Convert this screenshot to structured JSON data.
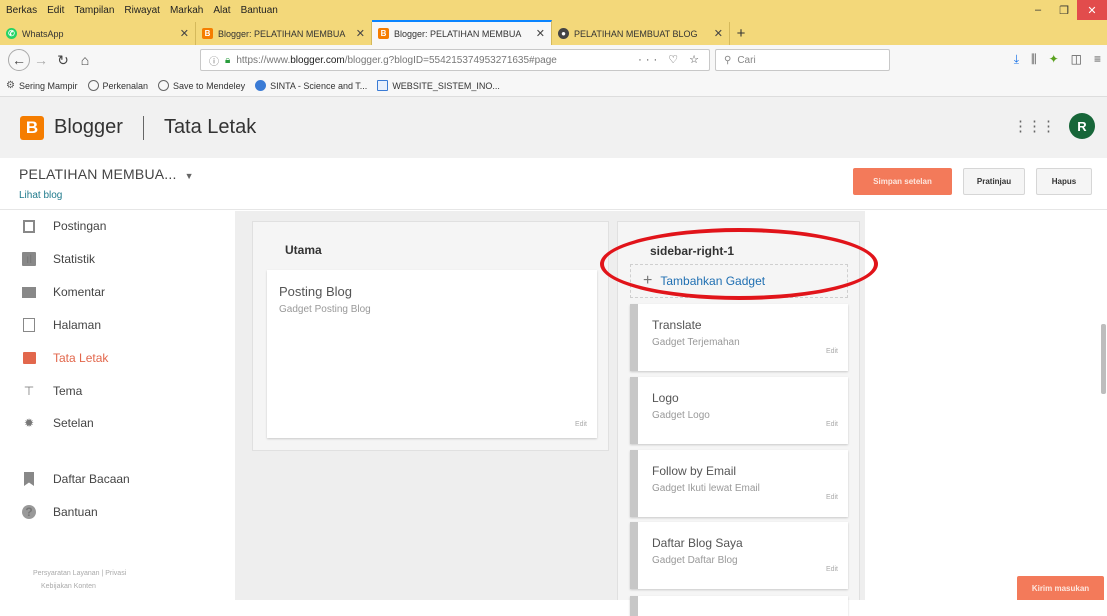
{
  "browser": {
    "menu": [
      "Berkas",
      "Edit",
      "Tampilan",
      "Riwayat",
      "Markah",
      "Alat",
      "Bantuan"
    ],
    "tabs": [
      {
        "label": "WhatsApp",
        "favicon": "whatsapp-icon",
        "active": false
      },
      {
        "label": "Blogger: PELATIHAN MEMBUA",
        "favicon": "blogger-icon",
        "active": false
      },
      {
        "label": "Blogger: PELATIHAN MEMBUA",
        "favicon": "blogger-icon",
        "active": true
      },
      {
        "label": "PELATIHAN MEMBUAT BLOG",
        "favicon": "globe-icon",
        "active": false
      }
    ],
    "url_prefix": "https://www.",
    "url_host": "blogger.com",
    "url_rest": "/blogger.g?blogID=554215374953271635#page",
    "search_placeholder": "Cari",
    "bookmarks": [
      {
        "label": "Sering Mampir",
        "icon": "gear-icon"
      },
      {
        "label": "Perkenalan",
        "icon": "globe-icon"
      },
      {
        "label": "Save to Mendeley",
        "icon": "globe-icon"
      },
      {
        "label": "SINTA - Science and T...",
        "icon": "sinta-icon"
      },
      {
        "label": "WEBSITE_SISTEM_INO...",
        "icon": "page-icon"
      }
    ]
  },
  "header": {
    "brand": "Blogger",
    "title": "Tata Letak",
    "avatar_initial": "R"
  },
  "blog": {
    "name": "PELATIHAN MEMBUA...",
    "view_link": "Lihat blog",
    "save_label": "Simpan setelan",
    "preview_label": "Pratinjau",
    "delete_label": "Hapus"
  },
  "sidebar": {
    "items": [
      {
        "label": "Postingan",
        "icon": "posts-icon"
      },
      {
        "label": "Statistik",
        "icon": "stats-icon"
      },
      {
        "label": "Komentar",
        "icon": "comment-icon"
      },
      {
        "label": "Halaman",
        "icon": "page-icon"
      },
      {
        "label": "Tata Letak",
        "icon": "layout-icon",
        "active": true
      },
      {
        "label": "Tema",
        "icon": "paint-roller-icon"
      },
      {
        "label": "Setelan",
        "icon": "gear-icon"
      },
      {
        "label": "Daftar Bacaan",
        "icon": "bookmark-icon"
      },
      {
        "label": "Bantuan",
        "icon": "help-icon"
      }
    ],
    "footer_line1": "Persyaratan Layanan  |  Privasi",
    "footer_line2": "Kebijakan Konten"
  },
  "layout": {
    "main": {
      "title": "Utama",
      "gadget": {
        "title": "Posting Blog",
        "subtitle": "Gadget Posting Blog",
        "edit": "Edit"
      }
    },
    "sidebar_right": {
      "title": "sidebar-right-1",
      "add_gadget": "Tambahkan Gadget",
      "gadgets": [
        {
          "title": "Translate",
          "subtitle": "Gadget Terjemahan",
          "edit": "Edit"
        },
        {
          "title": "Logo",
          "subtitle": "Gadget Logo",
          "edit": "Edit"
        },
        {
          "title": "Follow by Email",
          "subtitle": "Gadget Ikuti lewat Email",
          "edit": "Edit"
        },
        {
          "title": "Daftar Blog Saya",
          "subtitle": "Gadget Daftar Blog",
          "edit": "Edit"
        }
      ]
    }
  },
  "feedback_label": "Kirim masukan",
  "colors": {
    "blogger_orange": "#f57d00",
    "accent": "#f37a5a",
    "active_nav": "#e2674c",
    "link": "#1f6fb2",
    "annotation": "#e1141a"
  }
}
